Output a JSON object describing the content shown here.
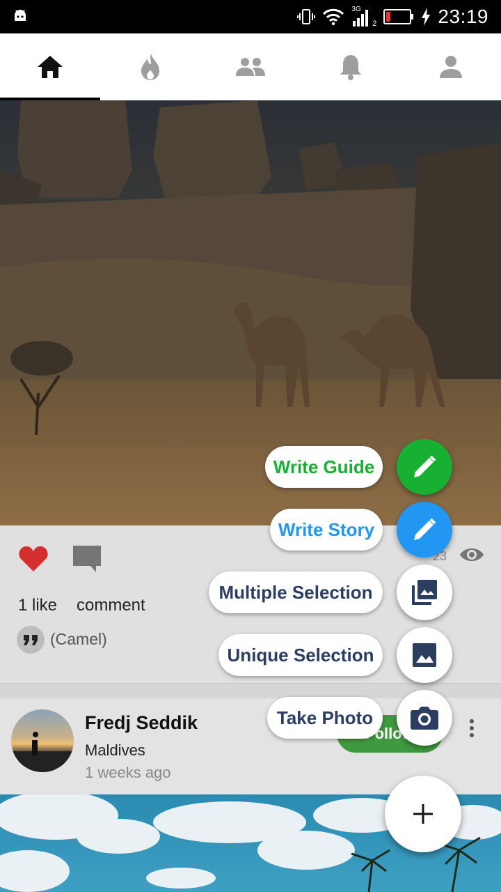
{
  "status_bar": {
    "time": "23:19",
    "network": "3G",
    "sim": "2"
  },
  "tabs": [
    {
      "name": "home",
      "icon": "home-icon",
      "active": true
    },
    {
      "name": "trending",
      "icon": "fire-icon",
      "active": false
    },
    {
      "name": "friends",
      "icon": "people-icon",
      "active": false
    },
    {
      "name": "notifications",
      "icon": "bell-icon",
      "active": false
    },
    {
      "name": "profile",
      "icon": "person-icon",
      "active": false
    }
  ],
  "post1": {
    "likes_label": "1 like",
    "comment_label": "comment",
    "views": "23",
    "caption": "(Camel)"
  },
  "post2": {
    "author": "Fredj  Seddik",
    "location": "Maldives",
    "time_ago": "1 weeks ago",
    "follow_label": "Follow"
  },
  "fab_menu": {
    "write_guide": "Write Guide",
    "write_story": "Write Story",
    "multiple_selection": "Multiple Selection",
    "unique_selection": "Unique Selection",
    "take_photo": "Take Photo"
  },
  "colors": {
    "guide_green": "#17b032",
    "story_blue": "#2196f3",
    "navy_label": "#2c3e60",
    "like_red": "#d32f2f"
  }
}
